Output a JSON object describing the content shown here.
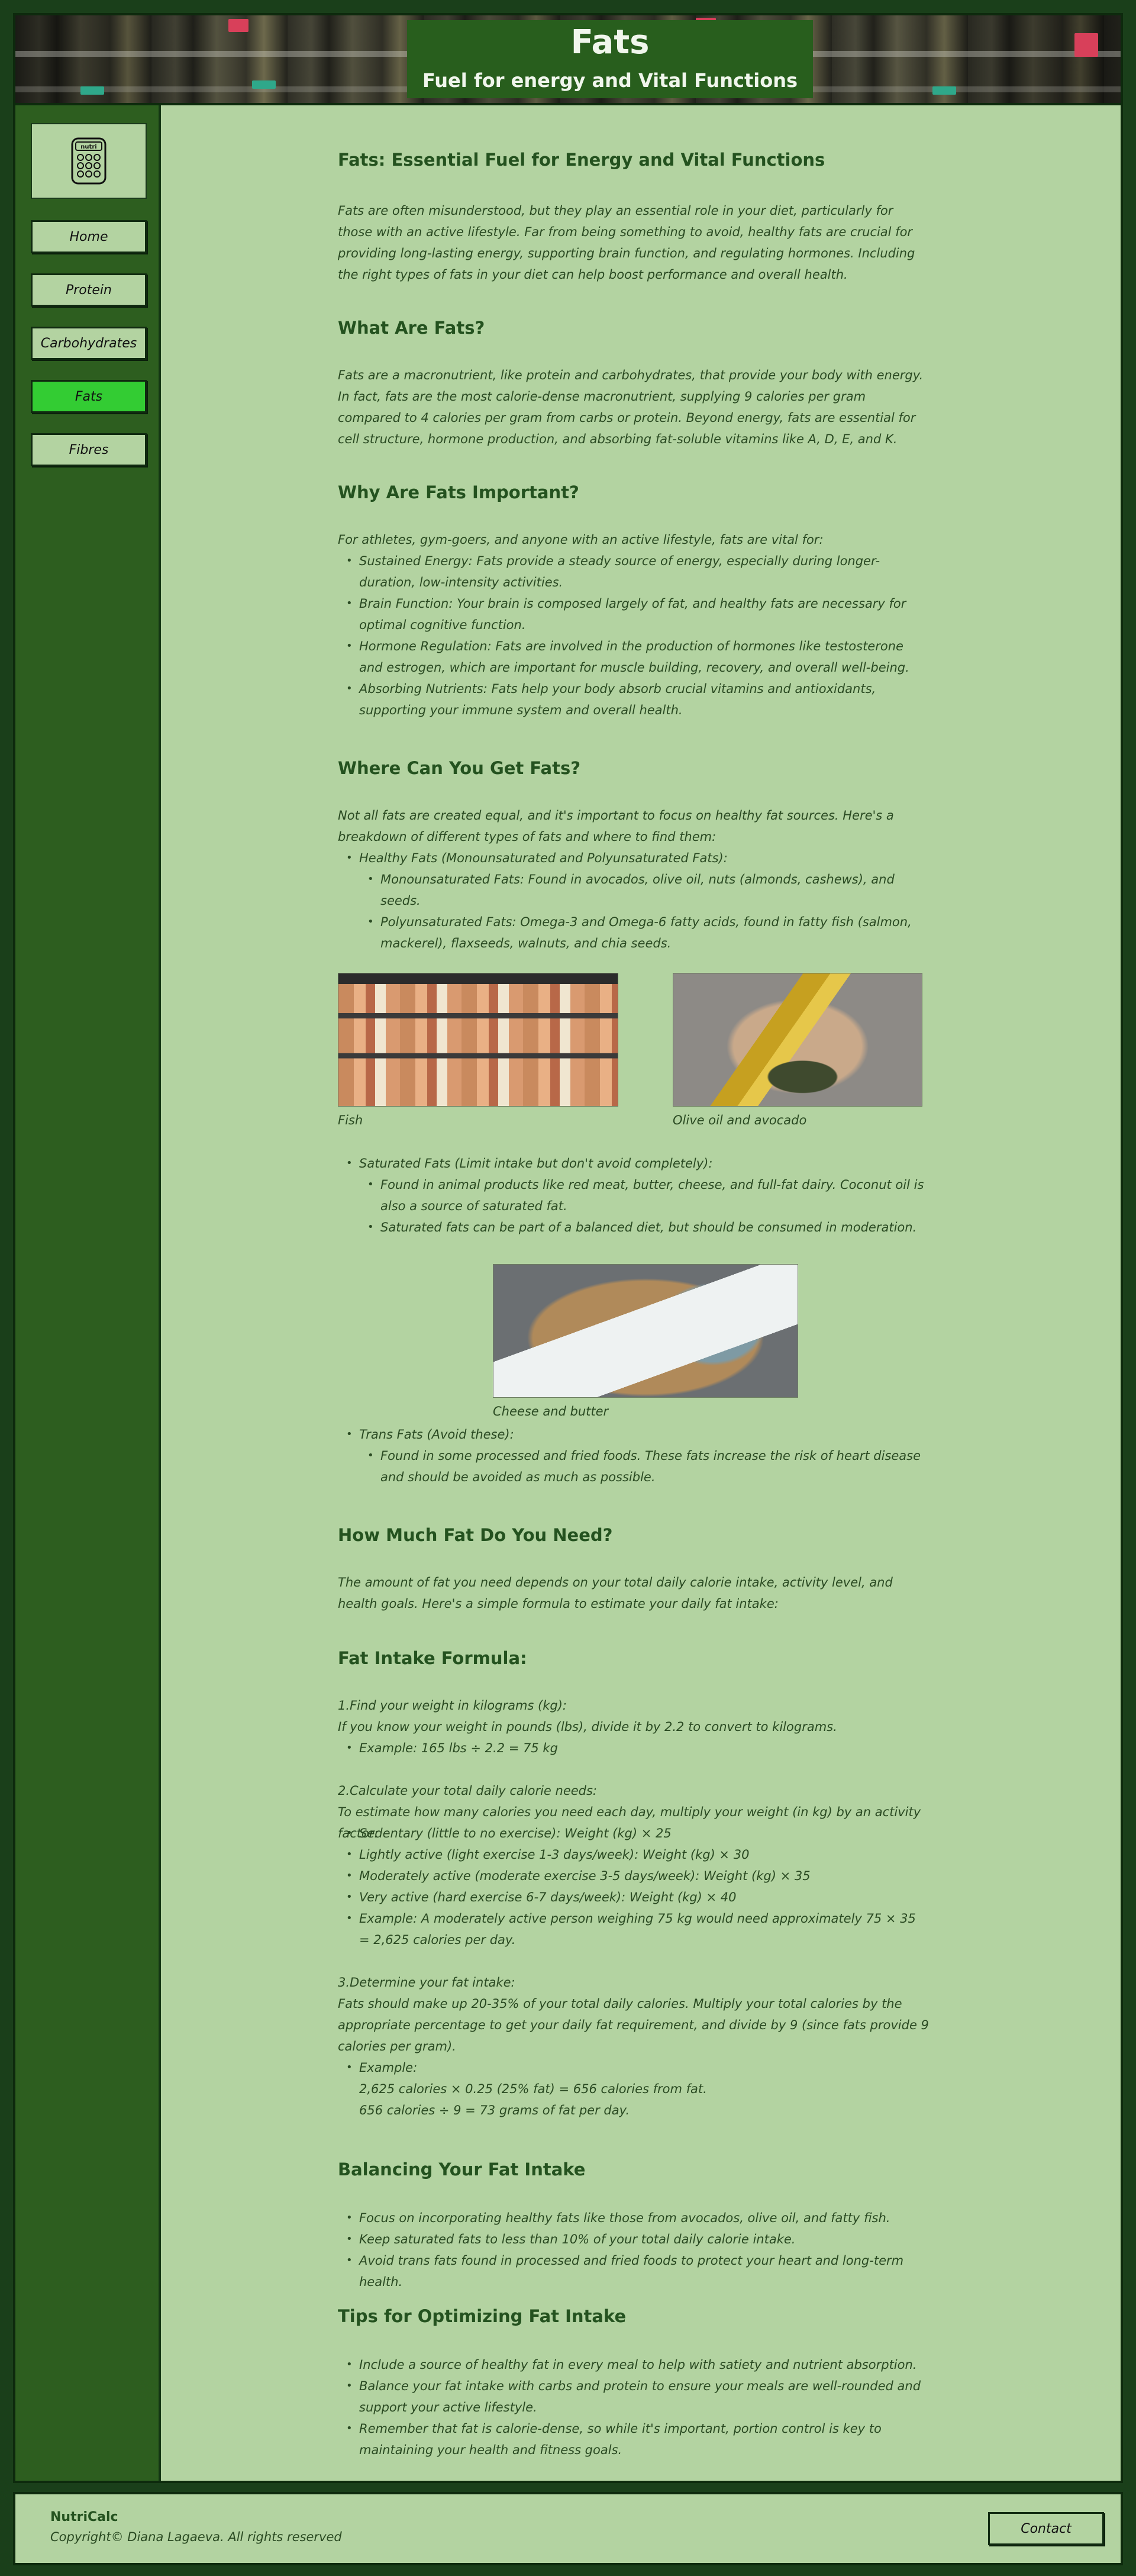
{
  "header": {
    "title": "Fats",
    "subtitle": "Fuel for energy and Vital Functions"
  },
  "sidebar": {
    "logo_text": "nutri",
    "nav": [
      {
        "label": "Home",
        "active": false
      },
      {
        "label": "Protein",
        "active": false
      },
      {
        "label": "Carbohydrates",
        "active": false
      },
      {
        "label": "Fats",
        "active": true
      },
      {
        "label": "Fibres",
        "active": false
      }
    ],
    "active_color": "#33cc33"
  },
  "main": {
    "title": "Fats: Essential Fuel for Energy and Vital Functions",
    "intro": "Fats are often misunderstood, but they play an essential role in your diet, particularly for those with an active lifestyle. Far from being something to avoid, healthy fats are crucial for providing long-lasting energy, supporting brain function, and regulating hormones. Including the right types of fats in your diet can help boost performance and overall health.",
    "what": {
      "heading": "What Are Fats?",
      "text": "Fats are a macronutrient, like protein and carbohydrates, that provide your body with energy. In fact, fats are the most calorie-dense macronutrient, supplying 9 calories per gram compared to 4 calories per gram from carbs or protein. Beyond energy, fats are essential for cell structure, hormone production, and absorbing fat-soluble vitamins like A, D, E, and K."
    },
    "why": {
      "heading": "Why Are Fats Important?",
      "lead": "For athletes, gym-goers, and anyone with an active lifestyle, fats are vital for:",
      "items": [
        "Sustained Energy: Fats provide a steady source of energy, especially during longer-duration, low-intensity activities.",
        "Brain Function: Your brain is composed largely of fat, and healthy fats are necessary for optimal cognitive function.",
        "Hormone Regulation: Fats are involved in the production of hormones like testosterone and estrogen, which are important for muscle building, recovery, and overall well-being.",
        "Absorbing Nutrients: Fats help your body absorb crucial vitamins and antioxidants, supporting your immune system and overall health."
      ]
    },
    "where": {
      "heading": "Where Can You Get Fats?",
      "lead": "Not all fats are created equal, and it's important to focus on healthy fat sources. Here's a breakdown of different types of fats and where to find them:",
      "healthy": "Healthy Fats (Monounsaturated and Polyunsaturated Fats):",
      "mono": "Monounsaturated Fats: Found in avocados, olive oil, nuts (almonds, cashews), and seeds.",
      "poly": "Polyunsaturated Fats: Omega-3 and Omega-6 fatty acids, found in fatty fish (salmon, mackerel), flaxseeds, walnuts, and chia seeds.",
      "fish_caption": "Fish",
      "oil_caption": "Olive oil and avocado",
      "saturated": "Saturated Fats (Limit intake but don't avoid completely):",
      "sat_1": "Found in animal products like red meat, butter, cheese, and full-fat dairy. Coconut oil is also a source of saturated fat.",
      "sat_2": "Saturated fats can be part of a balanced diet, but should be consumed in moderation.",
      "cheese_caption": "Cheese and butter",
      "trans": "Trans Fats (Avoid these):",
      "trans_1": "Found in some processed and fried foods. These fats increase the risk of heart disease and should be avoided as much as possible."
    },
    "how_much": {
      "heading": "How Much Fat Do You Need?",
      "text": "The amount of fat you need depends on your total daily calorie intake, activity level, and health goals. Here's a simple formula to estimate your daily fat intake:"
    },
    "formula": {
      "heading": "Fat Intake Formula:",
      "step1_title": "1.Find your weight in kilograms (kg):",
      "step1_text": "If you know your weight in pounds (lbs), divide it by 2.2 to convert to kilograms.",
      "step1_example": "Example: 165 lbs ÷ 2.2 = 75 kg",
      "step2_title": "2.Calculate your total daily calorie needs:",
      "step2_text": "To estimate how many calories you need each day, multiply your weight (in kg) by an activity factor:",
      "step2_items": [
        "Sedentary (little to no exercise): Weight (kg) × 25",
        "Lightly active (light exercise 1-3 days/week): Weight (kg) × 30",
        "Moderately active (moderate exercise 3-5 days/week): Weight (kg) × 35",
        "Very active (hard exercise 6-7 days/week): Weight (kg) × 40",
        "Example: A moderately active person weighing 75 kg would need approximately 75 × 35 = 2,625 calories per day."
      ],
      "step3_title": "3.Determine your fat intake:",
      "step3_text": "Fats should make up 20-35% of your total daily calories. Multiply your total calories by the appropriate percentage to get your daily fat requirement, and divide by 9 (since fats provide 9 calories per gram).",
      "step3_example_label": "Example:",
      "step3_example_1": "2,625 calories × 0.25 (25% fat) = 656 calories from fat.",
      "step3_example_2": "656 calories ÷ 9 = 73 grams of fat per day."
    },
    "balancing": {
      "heading": "Balancing Your Fat Intake",
      "items": [
        "Focus on incorporating healthy fats like those from avocados, olive oil, and fatty fish.",
        "Keep saturated fats to less than 10% of your total daily calorie intake.",
        "Avoid trans fats found in processed and fried foods to protect your heart and long-term health."
      ]
    },
    "tips": {
      "heading": "Tips for Optimizing Fat Intake",
      "items": [
        "Include a source of healthy fat in every meal to help with satiety and nutrient absorption.",
        "Balance your fat intake with carbs and protein to ensure your meals are well-rounded and support your active lifestyle.",
        "Remember that fat is calorie-dense, so while it's important, portion control is key to maintaining your health and fitness goals."
      ]
    }
  },
  "footer": {
    "brand": "NutriCalc",
    "copyright": "Copyright© Diana Lagaeva. All rights reserved",
    "contact_label": "Contact"
  }
}
